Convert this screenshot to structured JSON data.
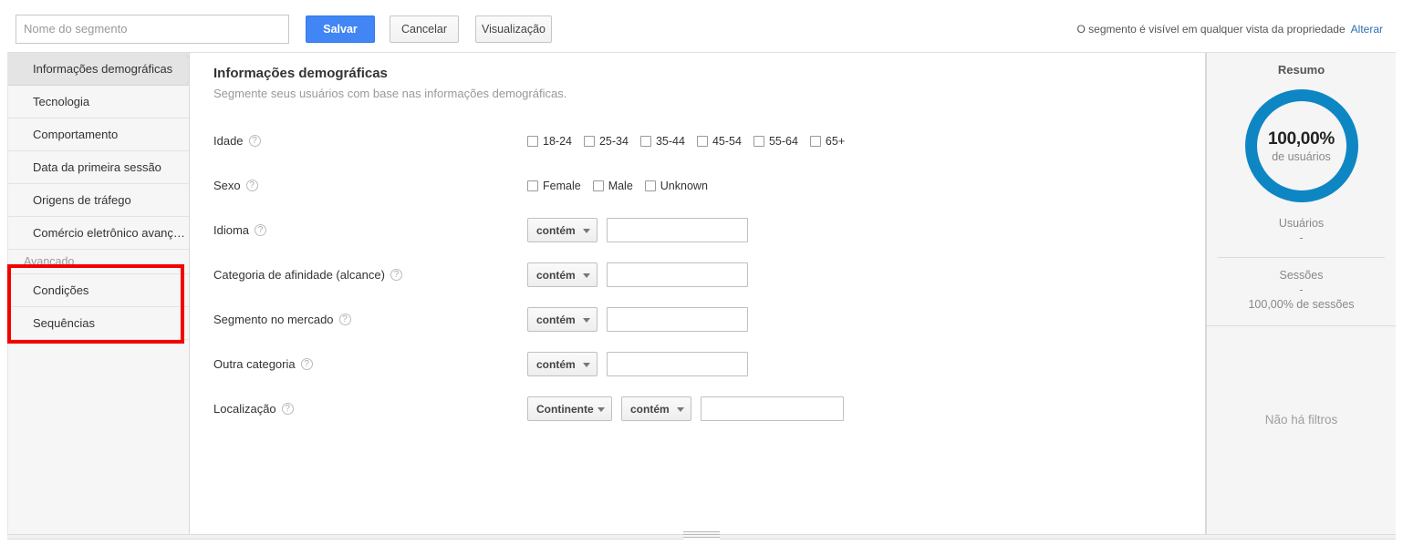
{
  "header": {
    "segment_name_placeholder": "Nome do segmento",
    "segment_name_value": "",
    "save_label": "Salvar",
    "cancel_label": "Cancelar",
    "preview_label": "Visualização",
    "visibility_text": "O segmento é visível em qualquer vista da propriedade",
    "change_link": "Alterar"
  },
  "sidebar": {
    "items": [
      {
        "label": "Informações demográficas",
        "selected": true
      },
      {
        "label": "Tecnologia",
        "selected": false
      },
      {
        "label": "Comportamento",
        "selected": false
      },
      {
        "label": "Data da primeira sessão",
        "selected": false
      },
      {
        "label": "Origens de tráfego",
        "selected": false
      },
      {
        "label": "Comércio eletrônico avanç…",
        "selected": false
      }
    ],
    "group_label": "Avançado",
    "advanced_items": [
      {
        "label": "Condições"
      },
      {
        "label": "Sequências"
      }
    ],
    "annotation_color": "#f40000"
  },
  "main": {
    "title": "Informações demográficas",
    "subtitle": "Segmente seus usuários com base nas informações demográficas.",
    "help_glyph": "?",
    "age": {
      "label": "Idade",
      "options": [
        "18-24",
        "25-34",
        "35-44",
        "45-54",
        "55-64",
        "65+"
      ],
      "checked": [
        false,
        false,
        false,
        false,
        false,
        false
      ]
    },
    "gender": {
      "label": "Sexo",
      "options": [
        "Female",
        "Male",
        "Unknown"
      ],
      "checked": [
        false,
        false,
        false
      ]
    },
    "language": {
      "label": "Idioma",
      "operator": "contém",
      "value": ""
    },
    "affinity": {
      "label": "Categoria de afinidade (alcance)",
      "operator": "contém",
      "value": ""
    },
    "in_market": {
      "label": "Segmento no mercado",
      "operator": "contém",
      "value": ""
    },
    "other_category": {
      "label": "Outra categoria",
      "operator": "contém",
      "value": ""
    },
    "location": {
      "label": "Localização",
      "dimension": "Continente",
      "operator": "contém",
      "value": ""
    }
  },
  "summary": {
    "title": "Resumo",
    "donut_percent": "100,00%",
    "donut_sub": "de usuários",
    "donut_color": "#0f86c4",
    "users_label": "Usuários",
    "users_value": "-",
    "sessions_label": "Sessões",
    "sessions_value": "-",
    "sessions_percent": "100,00% de sessões",
    "no_filters": "Não há filtros"
  }
}
